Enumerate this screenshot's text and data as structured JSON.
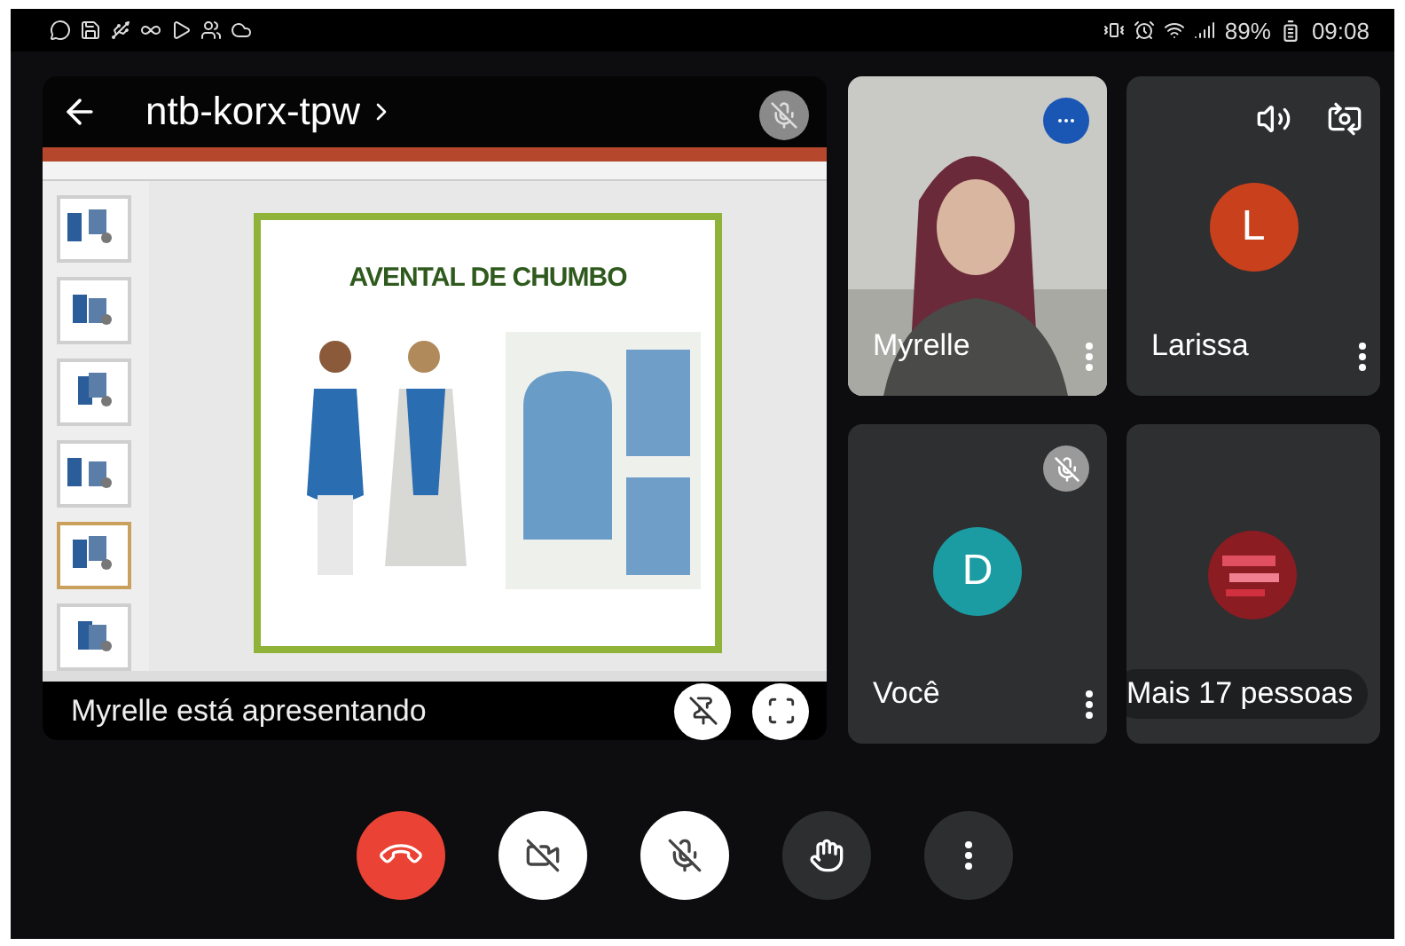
{
  "status_bar": {
    "battery": "89%",
    "time": "09:08"
  },
  "presentation": {
    "meeting_code": "ntb-korx-tpw",
    "presenter_muted": true,
    "slide": {
      "title": "AVENTAL DE CHUMBO",
      "thumbnails": [
        {
          "selected": false
        },
        {
          "selected": false
        },
        {
          "selected": false
        },
        {
          "selected": false
        },
        {
          "selected": true
        },
        {
          "selected": false
        }
      ]
    },
    "caption": "Myrelle está apresentando"
  },
  "participants": [
    {
      "name": "Myrelle",
      "kind": "video",
      "muted": false,
      "speaking": true
    },
    {
      "name": "Larissa",
      "kind": "avatar",
      "initial": "L",
      "color": "#c8401c",
      "muted": false,
      "speaking": false
    },
    {
      "name": "Você",
      "kind": "avatar",
      "initial": "D",
      "color": "#1b9ca3",
      "muted": true,
      "speaking": false
    },
    {
      "name": "Mais 17 pessoas",
      "kind": "more"
    }
  ],
  "controls": [
    {
      "kind": "end_call"
    },
    {
      "kind": "camera",
      "on": false
    },
    {
      "kind": "mic",
      "on": false
    },
    {
      "kind": "hand"
    },
    {
      "kind": "more"
    }
  ]
}
